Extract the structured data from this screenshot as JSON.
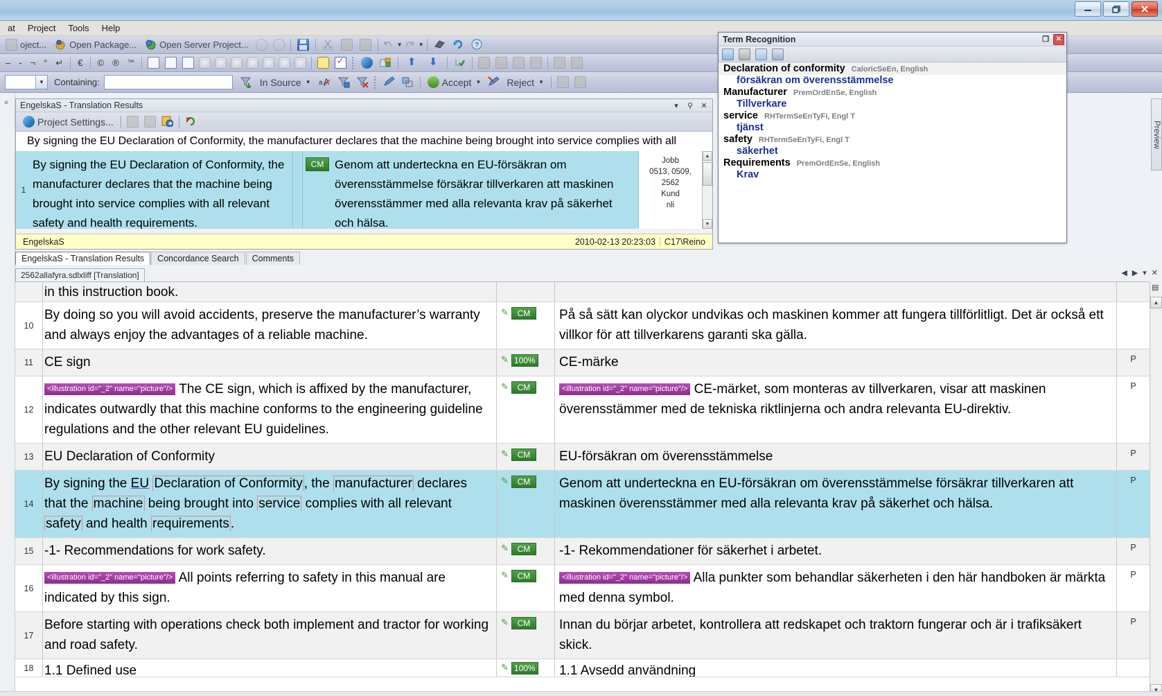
{
  "window": {
    "controls": {
      "minimize": "–",
      "restore": "❐",
      "close": "✕"
    }
  },
  "menu": {
    "items": [
      "at",
      "Project",
      "Tools",
      "Help"
    ]
  },
  "toolbar_main": {
    "open_project": "oject...",
    "open_package": "Open Package...",
    "open_server_project": "Open Server Project..."
  },
  "toolbar_chars": {
    "items": [
      "–",
      "-",
      "¬",
      "°",
      "↵",
      "€",
      "©",
      "®",
      "™"
    ]
  },
  "filter_bar": {
    "containing_label": "Containing:",
    "containing_value": "",
    "containing_placeholder": "",
    "in_source": "In Source",
    "accept": "Accept",
    "reject": "Reject"
  },
  "translation_results": {
    "title": "EngelskaS - Translation Results",
    "project_settings": "Project Settings...",
    "source_preview": "By signing the EU Declaration of Conformity, the manufacturer declares that the machine being brought into service complies with all",
    "row": {
      "number": "1",
      "source": "By signing the EU Declaration of Conformity, the manufacturer declares that the machine being brought into service complies with all relevant safety and health requirements.",
      "match_tag": "CM",
      "target": "Genom att underteckna en EU-försäkran om överensstämmelse försäkrar tillverkaren att maskinen överensstämmer med alla relevanta krav på säkerhet och hälsa.",
      "meta": [
        "Jobb",
        "0513, 0509,",
        "2562",
        "Kund",
        "nli"
      ]
    },
    "status": {
      "tm_name": "EngelskaS",
      "timestamp": "2010-02-13 20:23:03",
      "user": "C17\\Reino"
    },
    "tabs": [
      {
        "label": "EngelskaS - Translation Results",
        "active": true
      },
      {
        "label": "Concordance Search",
        "active": false
      },
      {
        "label": "Comments",
        "active": false
      }
    ]
  },
  "term_recognition": {
    "title": "Term Recognition",
    "entries": [
      {
        "source": "Declaration of conformity",
        "meta": "CaloricSeEn, English",
        "target": "försäkran om överensstämmelse",
        "highlight": true
      },
      {
        "source": "Manufacturer",
        "meta": "PremOrdEnSe, English",
        "target": "Tillverkare",
        "highlight": false
      },
      {
        "source": "service",
        "meta": "RHTermSeEnTyFi, Engl T",
        "target": "tjänst",
        "highlight": false
      },
      {
        "source": "safety",
        "meta": "RHTermSeEnTyFi, Engl T",
        "target": "säkerhet",
        "highlight": false
      },
      {
        "source": "Requirements",
        "meta": "PremOrdEnSe, English",
        "target": "Krav",
        "highlight": false
      }
    ]
  },
  "preview_tab": {
    "label": "Preview"
  },
  "document": {
    "tab_label": "2562allafyra.sdlxliff [Translation]"
  },
  "editor": {
    "rows": [
      {
        "number": "",
        "source_parts": [
          {
            "type": "text",
            "value": "in this instruction book."
          }
        ],
        "status": "",
        "target_parts": [],
        "p": "",
        "alt": true,
        "selected": false,
        "partial_top": true
      },
      {
        "number": "10",
        "source_parts": [
          {
            "type": "text",
            "value": "By doing so you will avoid accidents, preserve the manufacturer’s warranty and always enjoy the advantages of a reliable machine."
          }
        ],
        "status": "CM",
        "target_parts": [
          {
            "type": "text",
            "value": "På så sätt kan olyckor undvikas och maskinen kommer att fungera tillförlitligt. Det är också ett villkor för att tillverkarens garanti ska gälla."
          }
        ],
        "p": "",
        "alt": false,
        "selected": false
      },
      {
        "number": "11",
        "source_parts": [
          {
            "type": "text",
            "value": "CE sign"
          }
        ],
        "status": "100%",
        "target_parts": [
          {
            "type": "text",
            "value": "CE-märke"
          }
        ],
        "p": "P",
        "alt": true,
        "selected": false
      },
      {
        "number": "12",
        "source_parts": [
          {
            "type": "tag",
            "value": "<illustration id=\"_2\" name=\"picture\"/>"
          },
          {
            "type": "text",
            "value": "The CE sign, which is affixed by the manufacturer, indicates outwardly that this machine conforms to the engineering guideline regulations and the other relevant EU guidelines."
          }
        ],
        "status": "CM",
        "target_parts": [
          {
            "type": "tag",
            "value": "<illustration id=\"_2\" name=\"picture\"/>"
          },
          {
            "type": "text",
            "value": "CE-märket, som monteras av tillverkaren, visar att maskinen överensstämmer med de tekniska riktlinjerna och andra relevanta EU-direktiv."
          }
        ],
        "p": "P",
        "alt": false,
        "selected": false
      },
      {
        "number": "13",
        "source_parts": [
          {
            "type": "text",
            "value": "EU Declaration of Conformity"
          }
        ],
        "status": "CM",
        "target_parts": [
          {
            "type": "text",
            "value": "EU-försäkran om överensstämmelse"
          }
        ],
        "p": "P",
        "alt": true,
        "selected": false
      },
      {
        "number": "14",
        "source_parts": [
          {
            "type": "rich-sentence",
            "value": "By signing the EU Declaration of Conformity, the manufacturer declares that the machine being brought into service complies with all relevant safety and health requirements."
          }
        ],
        "status": "CM",
        "target_parts": [
          {
            "type": "text",
            "value": "Genom att underteckna en EU-försäkran om överensstämmelse försäkrar tillverkaren att maskinen överensstämmer med alla relevanta krav på säkerhet och hälsa."
          }
        ],
        "p": "P",
        "alt": false,
        "selected": true
      },
      {
        "number": "15",
        "source_parts": [
          {
            "type": "text",
            "value": "-1- Recommendations for work safety."
          }
        ],
        "status": "CM",
        "target_parts": [
          {
            "type": "text",
            "value": "-1- Rekommendationer för säkerhet i arbetet."
          }
        ],
        "p": "P",
        "alt": true,
        "selected": false
      },
      {
        "number": "16",
        "source_parts": [
          {
            "type": "tag",
            "value": "<illustration id=\"_2\" name=\"picture\"/>"
          },
          {
            "type": "text",
            "value": "All points referring to safety in this manual are indicated by this sign."
          }
        ],
        "status": "CM",
        "target_parts": [
          {
            "type": "tag",
            "value": "<illustration id=\"_2\" name=\"picture\"/>"
          },
          {
            "type": "text",
            "value": "Alla punkter som behandlar säkerheten i den här handboken är märkta med denna symbol."
          }
        ],
        "p": "P",
        "alt": false,
        "selected": false
      },
      {
        "number": "17",
        "source_parts": [
          {
            "type": "text",
            "value": "Before starting with operations check both implement and tractor for working and road safety."
          }
        ],
        "status": "CM",
        "target_parts": [
          {
            "type": "text",
            "value": "Innan du börjar arbetet, kontrollera att redskapet och traktorn fungerar och är i trafiksäkert skick."
          }
        ],
        "p": "P",
        "alt": true,
        "selected": false
      },
      {
        "number": "18",
        "source_parts": [
          {
            "type": "text",
            "value": "1.1 Defined use"
          }
        ],
        "status": "100%",
        "target_parts": [
          {
            "type": "text",
            "value": "1.1 Avsedd användning"
          }
        ],
        "p": "",
        "alt": false,
        "selected": false,
        "partial_bottom": true
      }
    ]
  },
  "colors": {
    "match_green": "#2d7a2a",
    "tag_purple": "#8d2d8d",
    "selection_blue": "#ade0ec",
    "term_link_blue": "#1b2f8f",
    "status_yellow": "#ffffc8"
  }
}
